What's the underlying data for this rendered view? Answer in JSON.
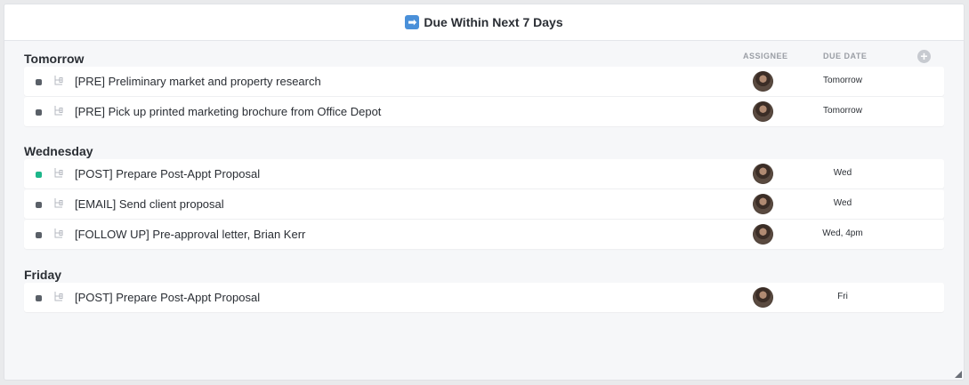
{
  "header": {
    "title": "Due Within Next 7 Days",
    "emoji_icon": "right-arrow-emoji-icon"
  },
  "columns": {
    "assignee": "ASSIGNEE",
    "due_date": "DUE DATE",
    "add_icon": "+"
  },
  "groups": [
    {
      "title": "Tomorrow",
      "tasks": [
        {
          "name": "[PRE] Preliminary market and property research",
          "due": "Tomorrow",
          "status_color": "#5a6068"
        },
        {
          "name": "[PRE] Pick up printed marketing brochure from Office Depot",
          "due": "Tomorrow",
          "status_color": "#5a6068"
        }
      ]
    },
    {
      "title": "Wednesday",
      "tasks": [
        {
          "name": "[POST] Prepare Post-Appt Proposal",
          "due": "Wed",
          "status_color": "#1db68a"
        },
        {
          "name": "[EMAIL] Send client proposal",
          "due": "Wed",
          "status_color": "#5a6068"
        },
        {
          "name": "[FOLLOW UP] Pre-approval letter, Brian Kerr",
          "due": "Wed, 4pm",
          "status_color": "#5a6068"
        }
      ]
    },
    {
      "title": "Friday",
      "tasks": [
        {
          "name": "[POST] Prepare Post-Appt Proposal",
          "due": "Fri",
          "status_color": "#5a6068"
        }
      ]
    }
  ]
}
